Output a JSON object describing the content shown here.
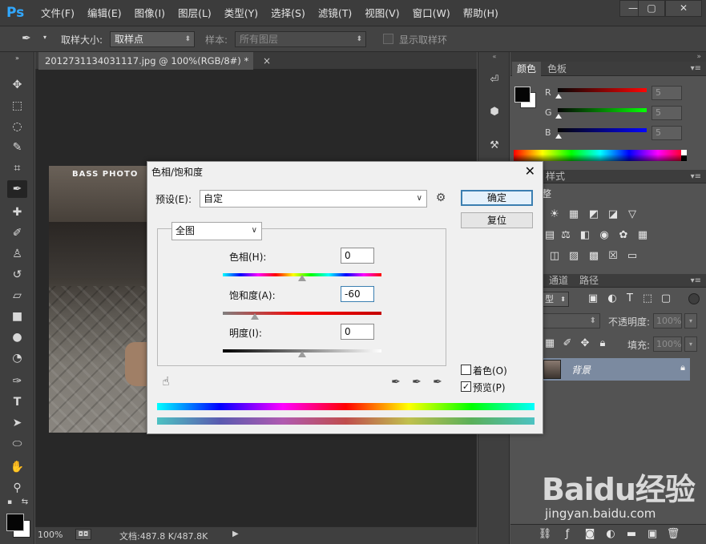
{
  "app": {
    "logo": "Ps",
    "menu": [
      "文件(F)",
      "编辑(E)",
      "图像(I)",
      "图层(L)",
      "类型(Y)",
      "选择(S)",
      "滤镜(T)",
      "视图(V)",
      "窗口(W)",
      "帮助(H)"
    ],
    "window_buttons": {
      "minimize": "—",
      "restore": "▢",
      "close": "✕"
    }
  },
  "options_bar": {
    "sample_size_label": "取样大小:",
    "sample_size_value": "取样点",
    "sample_label": "样本:",
    "sample_value": "所有图层",
    "show_ring_label": "显示取样环"
  },
  "document": {
    "tab_title": "2012731134031117.jpg @ 100%(RGB/8#) *",
    "tab_close": "×",
    "photo_logo": "BASS PHOTO",
    "zoom": "100%",
    "doc_size": "文档:487.8 K/487.8K"
  },
  "color_panel": {
    "tabs": [
      "颜色",
      "色板"
    ],
    "r_label": "R",
    "g_label": "G",
    "b_label": "B",
    "r_value": "5",
    "g_value": "5",
    "b_value": "5",
    "foreground": "#050505",
    "background": "#ffffff"
  },
  "adjust_panel": {
    "tab_styles": "样式",
    "partial_title": "整"
  },
  "layers_panel": {
    "tabs": [
      "通道",
      "路径"
    ],
    "kind_partial": "型",
    "opacity_label": "不透明度:",
    "opacity_value": "100%",
    "fill_label": "填充:",
    "fill_value": "100%",
    "layer_name": "背景"
  },
  "dialog": {
    "title": "色相/饱和度",
    "preset_label": "预设(E):",
    "preset_value": "自定",
    "ok_label": "确定",
    "reset_label": "复位",
    "channel_value": "全图",
    "hue_label": "色相(H):",
    "hue_value": "0",
    "saturation_label": "饱和度(A):",
    "saturation_value": "-60",
    "lightness_label": "明度(I):",
    "lightness_value": "0",
    "colorize_label": "着色(O)",
    "colorize_checked": false,
    "preview_label": "预览(P)",
    "preview_checked": true,
    "hue_level": 0.5,
    "saturation_level": 0.2,
    "lightness_level": 0.5
  },
  "watermark": {
    "main": "Baidu经验",
    "url": "jingyan.baidu.com"
  }
}
